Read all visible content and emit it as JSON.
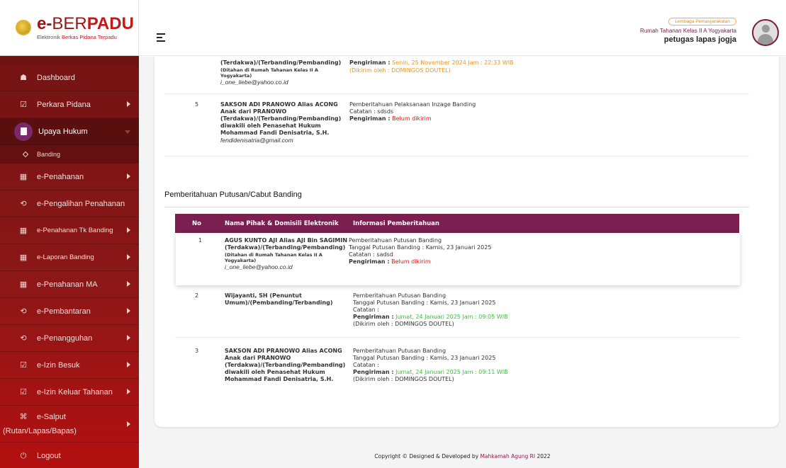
{
  "logo": {
    "e": "e-",
    "ber": "BER",
    "padu": "PADU",
    "sub_a": "Elektronik ",
    "sub_b": "Berkas",
    " sub_c": "",
    "sub_rest": " Pidana Terpadu"
  },
  "sidebar": {
    "items": [
      {
        "label": "Dashboard",
        "icon": "home-icon"
      },
      {
        "label": "Perkara Pidana",
        "icon": "folder-check-icon"
      },
      {
        "label": "Upaya Hukum",
        "icon": "document-icon"
      },
      {
        "label": "Banding",
        "icon": "diamond-icon"
      },
      {
        "label": "e-Penahanan",
        "icon": "grid-icon"
      },
      {
        "label": "e-Pengalihan Penahanan",
        "icon": "history-icon"
      },
      {
        "label": "e-Penahanan Tk Banding",
        "icon": "grid-icon"
      },
      {
        "label": "e-Laporan Banding",
        "icon": "grid-icon"
      },
      {
        "label": "e-Penahanan MA",
        "icon": "grid-icon"
      },
      {
        "label": "e-Pembantaran",
        "icon": "history-icon"
      },
      {
        "label": "e-Penangguhan",
        "icon": "history-icon"
      },
      {
        "label": "e-Izin Besuk",
        "icon": "handshake-icon"
      },
      {
        "label": "e-Izin Keluar Tahanan",
        "icon": "handshake-icon"
      },
      {
        "label": "e-Salput",
        "icon": "command-icon"
      },
      {
        "label": "(Rutan/Lapas/Bapas)",
        "icon": ""
      },
      {
        "label": "Logout",
        "icon": "power-icon"
      }
    ]
  },
  "header": {
    "badge": "Lembaga Pemasyarakatan",
    "org": "Rumah Tahanan Kelas II A Yogyakarta",
    "user": "petugas lapas jogja"
  },
  "prev": {
    "row4": {
      "name_a": "(Terdakwa)/(Terbanding/Pembanding)",
      "name_b": "(Ditahan di Rumah Tahanan Kelas II A",
      "name_c": "Yogyakarta)",
      "email": "i_one_liebe@yahoo.co.id",
      "pengiriman_label": "Pengiriman :",
      "pengiriman_value": "Senin, 25 November 2024 Jam : 22:33 WIB",
      "oleh": "(Dikirim oleh : DOMINGOS DOUTEL)"
    },
    "row5": {
      "no": "5",
      "name_1": "SAKSON ADI PRANOWO Alias ACONG",
      "name_2": "Anak dari PRANOWO",
      "name_3": "(Terdakwa)/(Terbanding/Pembanding)",
      "name_4": "diwakili oleh Penasehat Hukum",
      "name_5": "Mohammad Fandi Denisatria, S.H.",
      "email": "fendidenisatria@gmail.com",
      "info_1": "Pemberitahuan Pelaksanaan Inzage Banding",
      "info_2": "Catatan : sdsds",
      "pengiriman_label": "Pengiriman :",
      "pengiriman_value": "Belum dikirim"
    }
  },
  "section": {
    "title": "Pemberitahuan Putusan/Cabut Banding",
    "columns": [
      "No",
      "Nama Pihak & Domisili Elektronik",
      "Informasi Pemberitahuan"
    ],
    "rows": [
      {
        "no": "1",
        "name_1": "AGUS KUNTO AJI Alias AJI Bin SAGIMIN",
        "name_2": "(Terdakwa)/(Terbanding/Pembanding)",
        "name_3": "(Ditahan di Rumah Tahanan Kelas II A",
        "name_4": "Yogyakarta)",
        "email": "i_one_liebe@yahoo.co.id",
        "info_1": "Pemberitahuan Putusan Banding",
        "info_2": "Tanggal Putusan Banding : Kamis, 23 Januari 2025",
        "info_3": "Catatan : sadsd",
        "pengiriman_label": "Pengiriman :",
        "pengiriman_value": "Belum dikirim"
      },
      {
        "no": "2",
        "name_1": "Wijayanti, SH (Penuntut",
        "name_2": "Umum)/(Pembanding/Terbanding)",
        "info_1": "Pemberitahuan Putusan Banding",
        "info_2": "Tanggal Putusan Banding : Kamis, 23 Januari 2025",
        "info_3": "Catatan :",
        "pengiriman_label": "Pengiriman :",
        "pengiriman_value": "Jumat, 24 Januari 2025 Jam : 09:05 WIB",
        "oleh": "(Dikirim oleh : DOMINGOS DOUTEL)"
      },
      {
        "no": "3",
        "name_1": "SAKSON ADI PRANOWO Alias ACONG",
        "name_2": "Anak dari PRANOWO",
        "name_3": "(Terdakwa)/(Terbanding/Pembanding)",
        "name_4": "diwakili oleh Penasehat Hukum",
        "name_5": "Mohammad Fandi Denisatria, S.H.",
        "info_1": "Pemberitahuan Putusan Banding",
        "info_2": "Tanggal Putusan Banding : Kamis, 23 Januari 2025",
        "info_3": "Catatan :",
        "pengiriman_label": "Pengiriman :",
        "pengiriman_value": "Jumat, 24 Januari 2025 Jam : 09:11 WIB",
        "oleh": "(Dikirim oleh : DOMINGOS DOUTEL)"
      }
    ]
  },
  "footer": {
    "text": "Copyright © Designed & Developed by ",
    "link": "Mahkamah Agung RI",
    "year": " 2022"
  },
  "colors": {
    "sidebar": "#8b1a1a",
    "table_header": "#7a1f4f",
    "sent": "#3ec13e",
    "pending": "#d91515",
    "warning": "#e8961c"
  }
}
